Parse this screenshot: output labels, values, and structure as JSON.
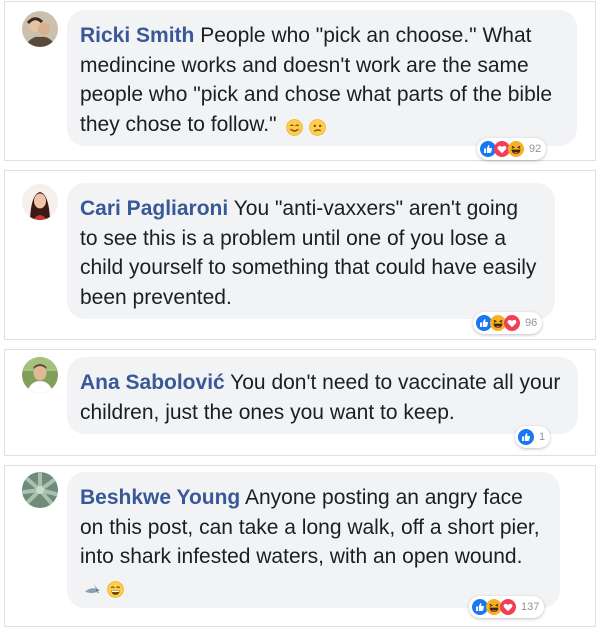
{
  "comments": [
    {
      "author": "Ricki Smith",
      "text": "People who \"pick an choose.\" What medincine works and doesn't work are the same people who \"pick and chose what parts of the bible they chose to follow.\"",
      "inline_emojis": [
        "smiling-face-icon",
        "confused-face-icon"
      ],
      "reactions": [
        "like",
        "love",
        "haha"
      ],
      "reaction_count": "92"
    },
    {
      "author": "Cari Pagliaroni",
      "text": "You \"anti-vaxxers\" aren't going to see this is a problem until one of you lose a child yourself to something that could have easily been prevented.",
      "reactions": [
        "like",
        "haha",
        "love"
      ],
      "reaction_count": "96"
    },
    {
      "author": "Ana Sabolović",
      "text": "You don't need to vaccinate all your children, just the ones you want to keep.",
      "reactions": [
        "like"
      ],
      "reaction_count": "1"
    },
    {
      "author": "Beshkwe Young",
      "text": "Anyone posting an angry face on this post, can take a long walk, off a short pier, into shark infested waters, with an open wound.",
      "inline_emojis": [
        "shark-icon",
        "grinning-face-icon"
      ],
      "reactions": [
        "like",
        "haha",
        "love"
      ],
      "reaction_count": "137"
    }
  ],
  "colors": {
    "author": "#385898",
    "bubble": "#f2f3f5",
    "like": "#1877f2",
    "love": "#f33e58",
    "haha": "#f7b125"
  }
}
